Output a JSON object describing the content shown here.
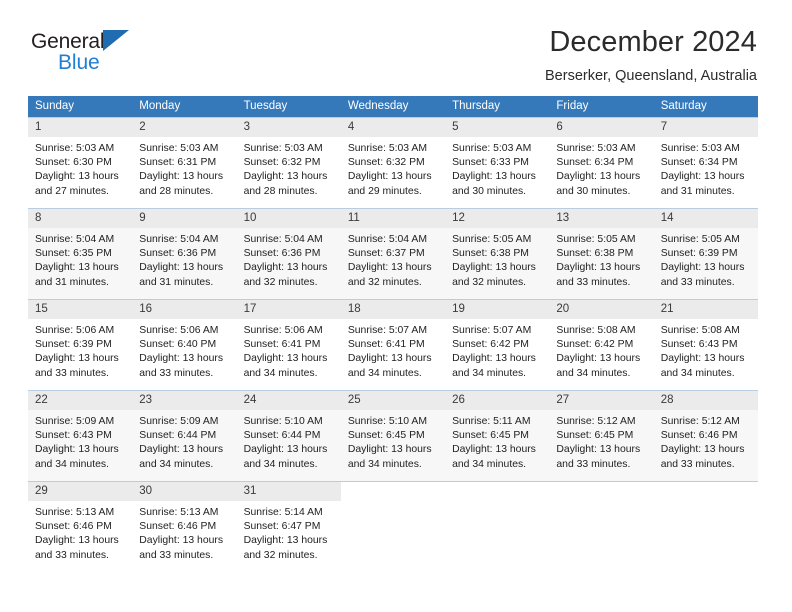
{
  "brand": {
    "name_top": "General",
    "name_bottom": "Blue",
    "triangle_color": "#1f6cb0",
    "blue_text_color": "#1f7fd4"
  },
  "header": {
    "title": "December 2024",
    "subtitle": "Berserker, Queensland, Australia"
  },
  "theme": {
    "header_row_bg": "#3579bb",
    "header_row_text": "#ffffff",
    "daynum_bg": "#ebebeb",
    "shaded_row_bg": "#f7f7f7",
    "grid_line": "#b9cde0"
  },
  "weekday_headers": [
    "Sunday",
    "Monday",
    "Tuesday",
    "Wednesday",
    "Thursday",
    "Friday",
    "Saturday"
  ],
  "weeks": [
    {
      "shaded": false,
      "days": [
        {
          "day": "1",
          "sunrise": "Sunrise: 5:03 AM",
          "sunset": "Sunset: 6:30 PM",
          "daylight_1": "Daylight: 13 hours",
          "daylight_2": "and 27 minutes."
        },
        {
          "day": "2",
          "sunrise": "Sunrise: 5:03 AM",
          "sunset": "Sunset: 6:31 PM",
          "daylight_1": "Daylight: 13 hours",
          "daylight_2": "and 28 minutes."
        },
        {
          "day": "3",
          "sunrise": "Sunrise: 5:03 AM",
          "sunset": "Sunset: 6:32 PM",
          "daylight_1": "Daylight: 13 hours",
          "daylight_2": "and 28 minutes."
        },
        {
          "day": "4",
          "sunrise": "Sunrise: 5:03 AM",
          "sunset": "Sunset: 6:32 PM",
          "daylight_1": "Daylight: 13 hours",
          "daylight_2": "and 29 minutes."
        },
        {
          "day": "5",
          "sunrise": "Sunrise: 5:03 AM",
          "sunset": "Sunset: 6:33 PM",
          "daylight_1": "Daylight: 13 hours",
          "daylight_2": "and 30 minutes."
        },
        {
          "day": "6",
          "sunrise": "Sunrise: 5:03 AM",
          "sunset": "Sunset: 6:34 PM",
          "daylight_1": "Daylight: 13 hours",
          "daylight_2": "and 30 minutes."
        },
        {
          "day": "7",
          "sunrise": "Sunrise: 5:03 AM",
          "sunset": "Sunset: 6:34 PM",
          "daylight_1": "Daylight: 13 hours",
          "daylight_2": "and 31 minutes."
        }
      ]
    },
    {
      "shaded": true,
      "days": [
        {
          "day": "8",
          "sunrise": "Sunrise: 5:04 AM",
          "sunset": "Sunset: 6:35 PM",
          "daylight_1": "Daylight: 13 hours",
          "daylight_2": "and 31 minutes."
        },
        {
          "day": "9",
          "sunrise": "Sunrise: 5:04 AM",
          "sunset": "Sunset: 6:36 PM",
          "daylight_1": "Daylight: 13 hours",
          "daylight_2": "and 31 minutes."
        },
        {
          "day": "10",
          "sunrise": "Sunrise: 5:04 AM",
          "sunset": "Sunset: 6:36 PM",
          "daylight_1": "Daylight: 13 hours",
          "daylight_2": "and 32 minutes."
        },
        {
          "day": "11",
          "sunrise": "Sunrise: 5:04 AM",
          "sunset": "Sunset: 6:37 PM",
          "daylight_1": "Daylight: 13 hours",
          "daylight_2": "and 32 minutes."
        },
        {
          "day": "12",
          "sunrise": "Sunrise: 5:05 AM",
          "sunset": "Sunset: 6:38 PM",
          "daylight_1": "Daylight: 13 hours",
          "daylight_2": "and 32 minutes."
        },
        {
          "day": "13",
          "sunrise": "Sunrise: 5:05 AM",
          "sunset": "Sunset: 6:38 PM",
          "daylight_1": "Daylight: 13 hours",
          "daylight_2": "and 33 minutes."
        },
        {
          "day": "14",
          "sunrise": "Sunrise: 5:05 AM",
          "sunset": "Sunset: 6:39 PM",
          "daylight_1": "Daylight: 13 hours",
          "daylight_2": "and 33 minutes."
        }
      ]
    },
    {
      "shaded": false,
      "days": [
        {
          "day": "15",
          "sunrise": "Sunrise: 5:06 AM",
          "sunset": "Sunset: 6:39 PM",
          "daylight_1": "Daylight: 13 hours",
          "daylight_2": "and 33 minutes."
        },
        {
          "day": "16",
          "sunrise": "Sunrise: 5:06 AM",
          "sunset": "Sunset: 6:40 PM",
          "daylight_1": "Daylight: 13 hours",
          "daylight_2": "and 33 minutes."
        },
        {
          "day": "17",
          "sunrise": "Sunrise: 5:06 AM",
          "sunset": "Sunset: 6:41 PM",
          "daylight_1": "Daylight: 13 hours",
          "daylight_2": "and 34 minutes."
        },
        {
          "day": "18",
          "sunrise": "Sunrise: 5:07 AM",
          "sunset": "Sunset: 6:41 PM",
          "daylight_1": "Daylight: 13 hours",
          "daylight_2": "and 34 minutes."
        },
        {
          "day": "19",
          "sunrise": "Sunrise: 5:07 AM",
          "sunset": "Sunset: 6:42 PM",
          "daylight_1": "Daylight: 13 hours",
          "daylight_2": "and 34 minutes."
        },
        {
          "day": "20",
          "sunrise": "Sunrise: 5:08 AM",
          "sunset": "Sunset: 6:42 PM",
          "daylight_1": "Daylight: 13 hours",
          "daylight_2": "and 34 minutes."
        },
        {
          "day": "21",
          "sunrise": "Sunrise: 5:08 AM",
          "sunset": "Sunset: 6:43 PM",
          "daylight_1": "Daylight: 13 hours",
          "daylight_2": "and 34 minutes."
        }
      ]
    },
    {
      "shaded": true,
      "days": [
        {
          "day": "22",
          "sunrise": "Sunrise: 5:09 AM",
          "sunset": "Sunset: 6:43 PM",
          "daylight_1": "Daylight: 13 hours",
          "daylight_2": "and 34 minutes."
        },
        {
          "day": "23",
          "sunrise": "Sunrise: 5:09 AM",
          "sunset": "Sunset: 6:44 PM",
          "daylight_1": "Daylight: 13 hours",
          "daylight_2": "and 34 minutes."
        },
        {
          "day": "24",
          "sunrise": "Sunrise: 5:10 AM",
          "sunset": "Sunset: 6:44 PM",
          "daylight_1": "Daylight: 13 hours",
          "daylight_2": "and 34 minutes."
        },
        {
          "day": "25",
          "sunrise": "Sunrise: 5:10 AM",
          "sunset": "Sunset: 6:45 PM",
          "daylight_1": "Daylight: 13 hours",
          "daylight_2": "and 34 minutes."
        },
        {
          "day": "26",
          "sunrise": "Sunrise: 5:11 AM",
          "sunset": "Sunset: 6:45 PM",
          "daylight_1": "Daylight: 13 hours",
          "daylight_2": "and 34 minutes."
        },
        {
          "day": "27",
          "sunrise": "Sunrise: 5:12 AM",
          "sunset": "Sunset: 6:45 PM",
          "daylight_1": "Daylight: 13 hours",
          "daylight_2": "and 33 minutes."
        },
        {
          "day": "28",
          "sunrise": "Sunrise: 5:12 AM",
          "sunset": "Sunset: 6:46 PM",
          "daylight_1": "Daylight: 13 hours",
          "daylight_2": "and 33 minutes."
        }
      ]
    },
    {
      "shaded": false,
      "days": [
        {
          "day": "29",
          "sunrise": "Sunrise: 5:13 AM",
          "sunset": "Sunset: 6:46 PM",
          "daylight_1": "Daylight: 13 hours",
          "daylight_2": "and 33 minutes."
        },
        {
          "day": "30",
          "sunrise": "Sunrise: 5:13 AM",
          "sunset": "Sunset: 6:46 PM",
          "daylight_1": "Daylight: 13 hours",
          "daylight_2": "and 33 minutes."
        },
        {
          "day": "31",
          "sunrise": "Sunrise: 5:14 AM",
          "sunset": "Sunset: 6:47 PM",
          "daylight_1": "Daylight: 13 hours",
          "daylight_2": "and 32 minutes."
        },
        null,
        null,
        null,
        null
      ]
    }
  ]
}
